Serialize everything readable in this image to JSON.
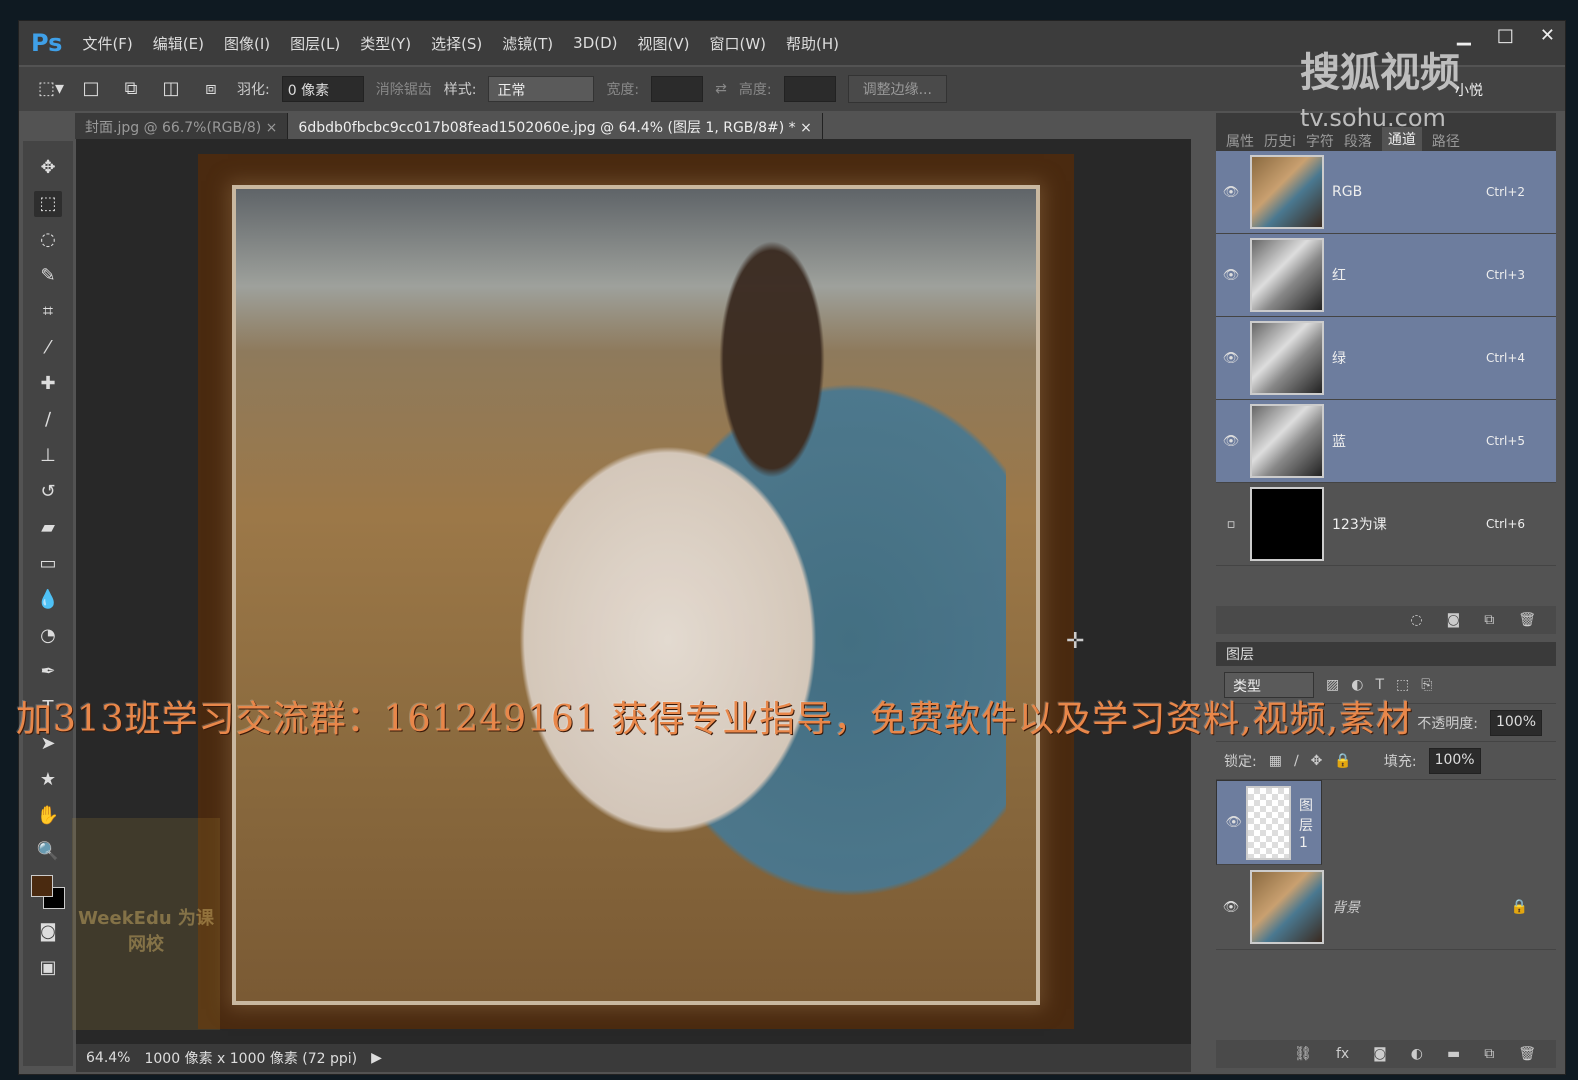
{
  "app": {
    "logo": "Ps",
    "menus": [
      "文件(F)",
      "编辑(E)",
      "图像(I)",
      "图层(L)",
      "类型(Y)",
      "选择(S)",
      "滤镜(T)",
      "3D(D)",
      "视图(V)",
      "窗口(W)",
      "帮助(H)"
    ],
    "window_buttons": [
      "▁",
      "□",
      "✕"
    ]
  },
  "options": {
    "feather_label": "羽化:",
    "feather_value": "0 像素",
    "antialias": "消除锯齿",
    "style_label": "样式:",
    "style_value": "正常",
    "width_label": "宽度:",
    "height_label": "高度:",
    "refine_edge": "调整边缘..."
  },
  "tabs": [
    {
      "label": "封面.jpg @ 66.7%(RGB/8)",
      "close": "×"
    },
    {
      "label": "6dbdb0fbcbc9cc017b08fead1502060e.jpg @ 64.4% (图层 1, RGB/8#) *",
      "close": "×"
    }
  ],
  "status": {
    "zoom": "64.4%",
    "dims": "1000 像素 x 1000 像素 (72 ppi)"
  },
  "panel_tabs": [
    "属性",
    "历史i",
    "字符",
    "段落",
    "通道",
    "路径"
  ],
  "channels": [
    {
      "name": "RGB",
      "shortcut": "Ctrl+2"
    },
    {
      "name": "红",
      "shortcut": "Ctrl+3"
    },
    {
      "name": "绿",
      "shortcut": "Ctrl+4"
    },
    {
      "name": "蓝",
      "shortcut": "Ctrl+5"
    },
    {
      "name": "123为课",
      "shortcut": "Ctrl+6"
    }
  ],
  "layers_panel": {
    "title": "图层",
    "filter": "类型",
    "opacity_label": "不透明度:",
    "opacity": "100%",
    "lock_label": "锁定:",
    "fill_label": "填充:",
    "fill": "100%",
    "layers": [
      {
        "name": "图层 1"
      },
      {
        "name": "背景"
      }
    ]
  },
  "overlay_text": "加313班学习交流群：161249161 获得专业指导，免费软件以及学习资料,视频,素材",
  "watermarks": {
    "sohu": "搜狐视频",
    "sohu_url": "tv.sohu.com",
    "user": "小悦",
    "weekedu": "WeekEdu 为课网校"
  }
}
